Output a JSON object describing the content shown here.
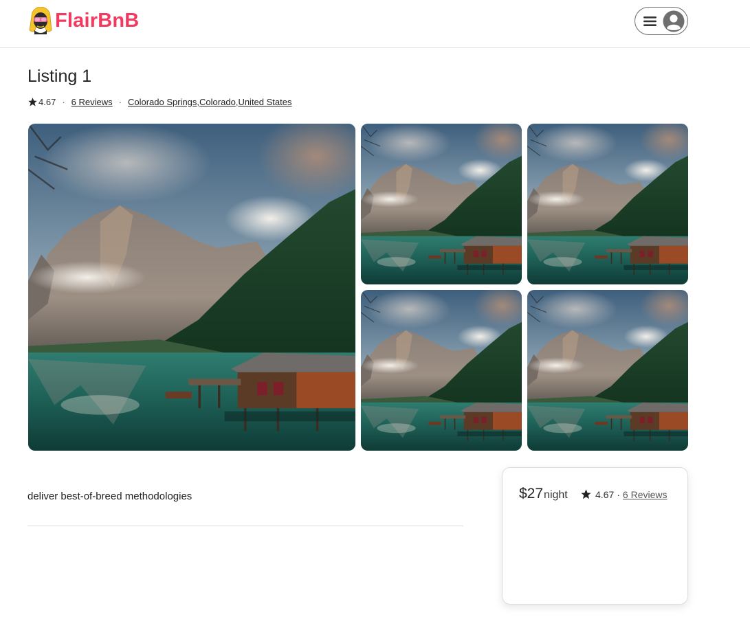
{
  "header": {
    "brand": "FlairBnB",
    "logo_icon": "logo-avatar-icon",
    "menu_icon": "hamburger-icon",
    "avatar_icon": "user-avatar-icon",
    "brand_color": "#f23a5e"
  },
  "listing": {
    "title": "Listing 1",
    "rating": "4.67",
    "reviews_link": "6 Reviews",
    "location": {
      "city": "Colorado Springs",
      "state": "Colorado",
      "country": "United States",
      "separator": ","
    },
    "meta_separator": "·"
  },
  "gallery": {
    "photos": [
      {
        "name": "main-photo",
        "subject": "mountain lake with boathouse"
      },
      {
        "name": "photo-2",
        "subject": "mountain lake with boathouse"
      },
      {
        "name": "photo-3",
        "subject": "mountain lake with boathouse"
      },
      {
        "name": "photo-4",
        "subject": "mountain lake with boathouse"
      },
      {
        "name": "photo-5",
        "subject": "mountain lake with boathouse"
      }
    ]
  },
  "description": "deliver best-of-breed methodologies",
  "booking": {
    "price": "$27",
    "per": "night",
    "rating": "4.67",
    "separator": "·",
    "reviews_link": "6 Reviews"
  }
}
